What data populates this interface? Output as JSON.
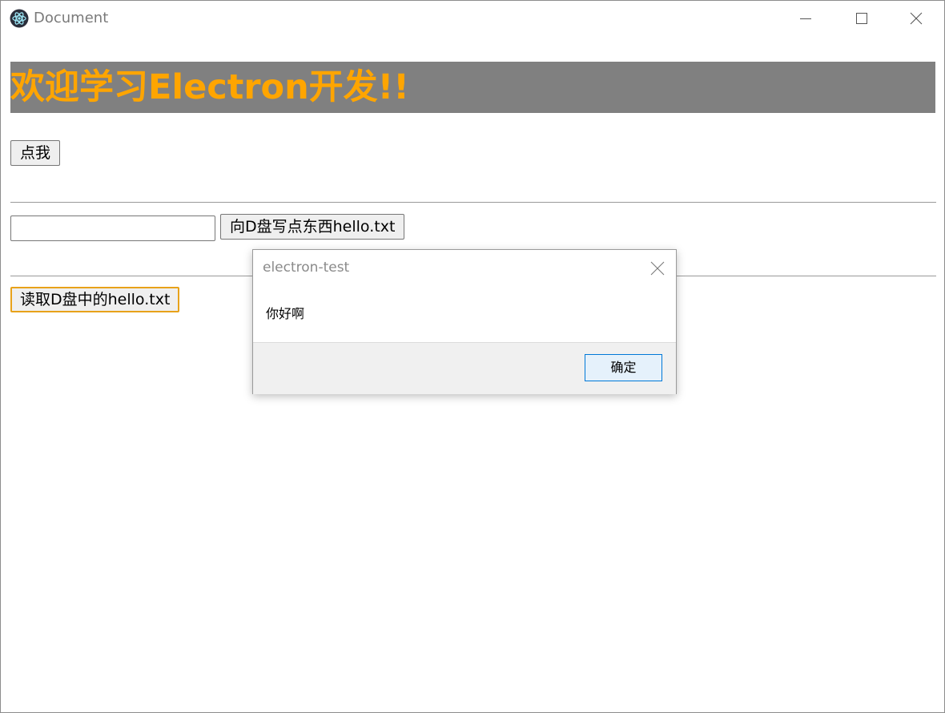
{
  "window": {
    "title": "Document",
    "app_icon": "electron-icon"
  },
  "page": {
    "banner_text": "欢迎学习Electron开发!!",
    "click_button_label": "点我",
    "text_input_value": "",
    "write_button_label": "向D盘写点东西hello.txt",
    "read_button_label": "读取D盘中的hello.txt"
  },
  "dialog": {
    "title": "electron-test",
    "message": "你好啊",
    "ok_button_label": "确定"
  },
  "colors": {
    "banner_text": "#FFA500",
    "banner_background": "#808080",
    "focus_outline": "#e8a21a",
    "dialog_button_border": "#0078d7"
  }
}
